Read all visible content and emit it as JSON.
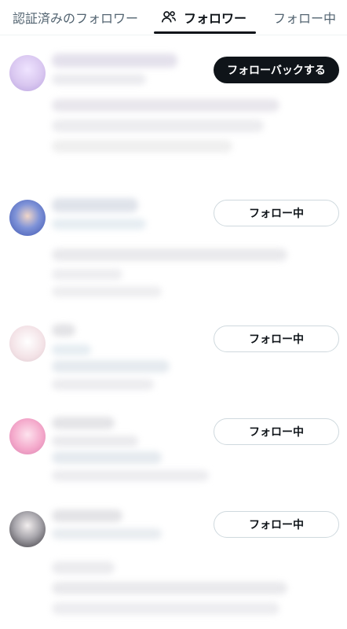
{
  "tabs": [
    {
      "label": "認証済みのフォロワー"
    },
    {
      "label": "フォロワー",
      "icon": "people-icon"
    },
    {
      "label": "フォロー中"
    }
  ],
  "rows": [
    {
      "button_label": "フォローバックする",
      "avatar_color": "#d9c7f0"
    },
    {
      "button_label": "フォロー中",
      "avatar_color": "#3e55b0"
    },
    {
      "button_label": "フォロー中",
      "avatar_color": "#f3e2e6"
    },
    {
      "button_label": "フォロー中",
      "avatar_color": "#f4a9cb"
    },
    {
      "button_label": "フォロー中",
      "avatar_color": "#6d6b72"
    }
  ]
}
